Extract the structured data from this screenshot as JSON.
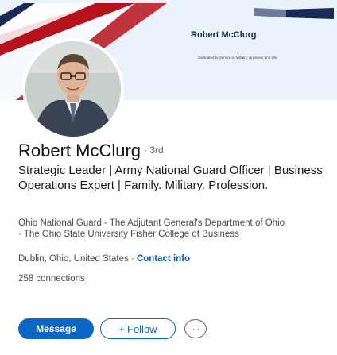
{
  "banner": {
    "name": "Robert McClurg",
    "tagline": "Dedicated to Service in Military, Business and Life"
  },
  "profile": {
    "name": "Robert McClurg",
    "degree": "· 3rd",
    "headline": "Strategic Leader | Army National Guard Officer | Business Operations Expert | Family. Military. Profession.",
    "experience": "Ohio National Guard - The Adjutant General's Department of Ohio",
    "education": "· The Ohio State University Fisher College of Business",
    "location": "Dublin, Ohio, United States",
    "location_sep": " · ",
    "contact_info": "Contact info",
    "connections": "258 connections"
  },
  "actions": {
    "message": "Message",
    "follow_plus": "+",
    "follow": "Follow",
    "more_icon": "ellipsis-icon",
    "more_glyph": "···"
  },
  "colors": {
    "accent": "#0a66c2",
    "banner_red": "#b5121b",
    "banner_navy": "#1a2a57"
  }
}
